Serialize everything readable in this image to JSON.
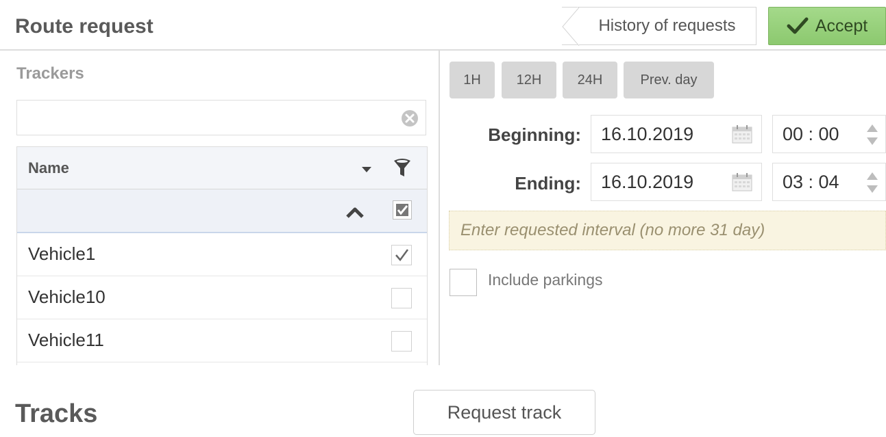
{
  "header": {
    "title": "Route request",
    "history_label": "History of requests",
    "accept_label": "Accept"
  },
  "trackers": {
    "label": "Trackers",
    "search_value": "",
    "column_name": "Name",
    "rows": [
      {
        "name": "Vehicle1",
        "checked": true
      },
      {
        "name": "Vehicle10",
        "checked": false
      },
      {
        "name": "Vehicle11",
        "checked": false
      }
    ]
  },
  "interval": {
    "quick_buttons": [
      "1H",
      "12H",
      "24H",
      "Prev. day"
    ],
    "beginning_label": "Beginning:",
    "ending_label": "Ending:",
    "beginning_date": "16.10.2019",
    "beginning_time": "00 : 00",
    "ending_date": "16.10.2019",
    "ending_time": "03 : 04",
    "hint": "Enter requested interval (no more 31 day)",
    "include_parkings_label": "Include parkings",
    "include_parkings_checked": false
  },
  "tracks": {
    "title": "Tracks",
    "request_label": "Request track"
  },
  "colors": {
    "accept_bg": "#8cc96f",
    "hint_bg": "#f9f4e1"
  }
}
